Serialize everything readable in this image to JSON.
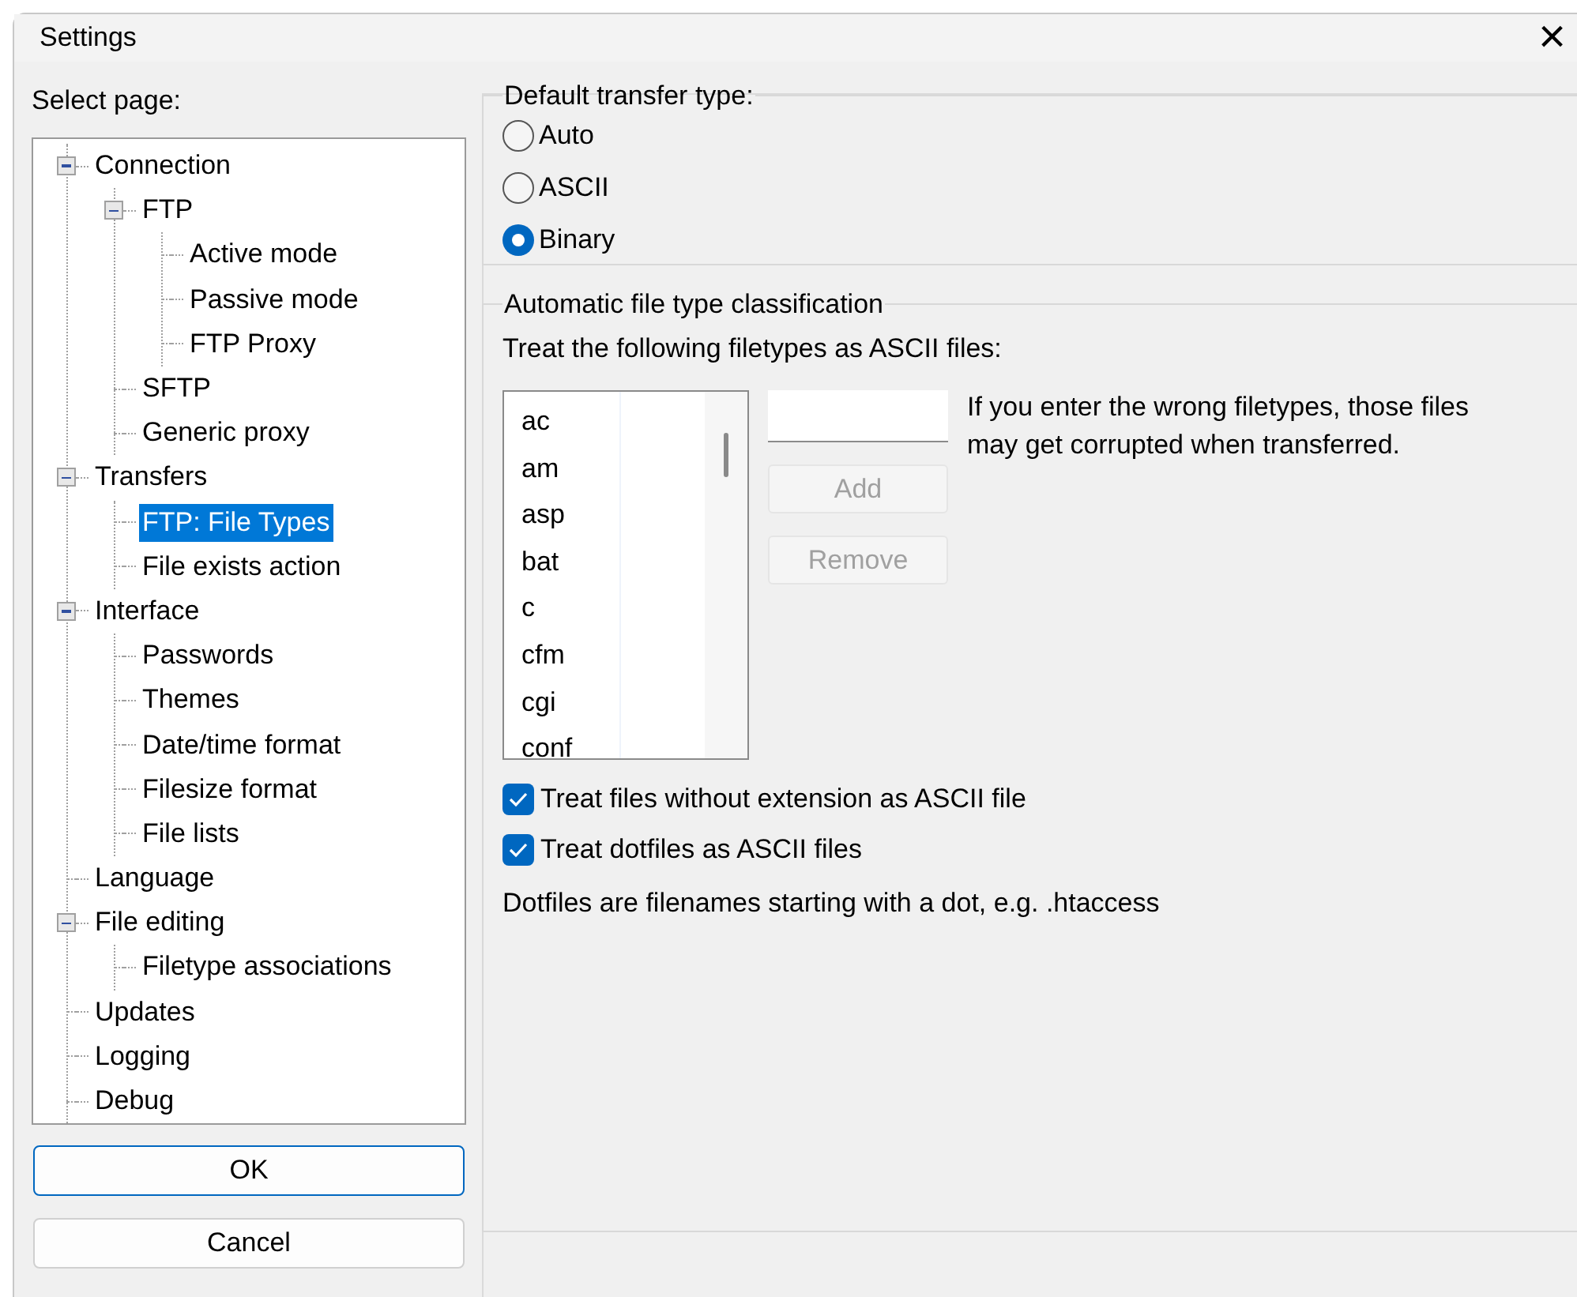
{
  "window": {
    "title": "Settings",
    "close": "×"
  },
  "sidebar": {
    "label": "Select page:",
    "tree": [
      {
        "label": "Connection",
        "expanded": true,
        "selected": false,
        "children": [
          {
            "label": "FTP",
            "expanded": true,
            "selected": false,
            "children": [
              {
                "label": "Active mode",
                "selected": false
              },
              {
                "label": "Passive mode",
                "selected": false
              },
              {
                "label": "FTP Proxy",
                "selected": false
              }
            ]
          },
          {
            "label": "SFTP",
            "selected": false
          },
          {
            "label": "Generic proxy",
            "selected": false
          }
        ]
      },
      {
        "label": "Transfers",
        "expanded": true,
        "selected": false,
        "children": [
          {
            "label": "FTP: File Types",
            "selected": true
          },
          {
            "label": "File exists action",
            "selected": false
          }
        ]
      },
      {
        "label": "Interface",
        "expanded": true,
        "selected": false,
        "children": [
          {
            "label": "Passwords",
            "selected": false
          },
          {
            "label": "Themes",
            "selected": false
          },
          {
            "label": "Date/time format",
            "selected": false
          },
          {
            "label": "Filesize format",
            "selected": false
          },
          {
            "label": "File lists",
            "selected": false
          }
        ]
      },
      {
        "label": "Language",
        "selected": false
      },
      {
        "label": "File editing",
        "expanded": true,
        "selected": false,
        "children": [
          {
            "label": "Filetype associations",
            "selected": false
          }
        ]
      },
      {
        "label": "Updates",
        "selected": false
      },
      {
        "label": "Logging",
        "selected": false
      },
      {
        "label": "Debug",
        "selected": false
      }
    ]
  },
  "buttons": [
    {
      "label": "OK",
      "default": true
    },
    {
      "label": "Cancel",
      "default": false
    }
  ],
  "transfer_type": {
    "title": "Default transfer type:",
    "options": [
      {
        "label": "Auto",
        "selected": false
      },
      {
        "label": "ASCII",
        "selected": false
      },
      {
        "label": "Binary",
        "selected": true
      }
    ]
  },
  "classification": {
    "title": "Automatic file type classification",
    "intro": "Treat the following filetypes as ASCII files:",
    "filetypes": [
      "ac",
      "am",
      "asp",
      "bat",
      "c",
      "cfm",
      "cgi",
      "conf"
    ],
    "actions": [
      {
        "label": "Add",
        "disabled": true
      },
      {
        "label": "Remove",
        "disabled": true
      }
    ],
    "warning": "If you enter the wrong filetypes, those files may get corrupted when transferred.",
    "checkboxes": [
      {
        "label": "Treat files without extension as ASCII file",
        "checked": true
      },
      {
        "label": "Treat dotfiles as ASCII files",
        "checked": true
      }
    ],
    "note": "Dotfiles are filenames starting with a dot, e.g. .htaccess"
  }
}
